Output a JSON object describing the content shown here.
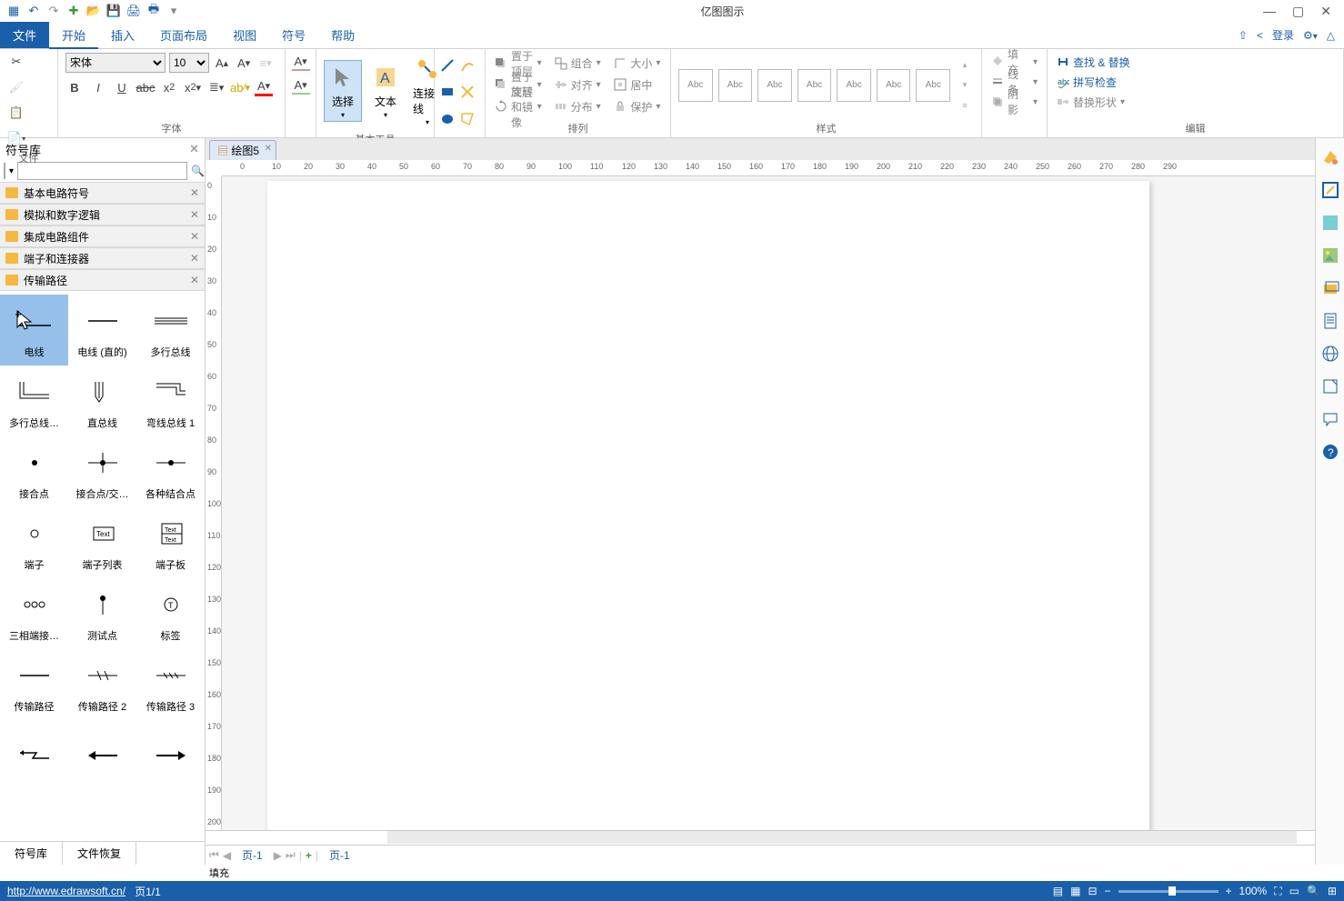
{
  "app": {
    "title": "亿图图示"
  },
  "qat": [
    "logo",
    "undo",
    "redo",
    "sep",
    "new",
    "open",
    "save",
    "print",
    "quickprint",
    "more"
  ],
  "window_controls": [
    "min",
    "max",
    "close"
  ],
  "menubar": {
    "tabs": [
      {
        "id": "file",
        "label": "文件",
        "type": "file"
      },
      {
        "id": "start",
        "label": "开始",
        "active": true
      },
      {
        "id": "insert",
        "label": "插入"
      },
      {
        "id": "layout",
        "label": "页面布局"
      },
      {
        "id": "view",
        "label": "视图"
      },
      {
        "id": "symbol",
        "label": "符号"
      },
      {
        "id": "help",
        "label": "帮助"
      }
    ],
    "right": [
      {
        "id": "export",
        "glyph": "⇪"
      },
      {
        "id": "share",
        "glyph": "<"
      },
      {
        "id": "login",
        "label": "登录"
      },
      {
        "id": "settings",
        "glyph": "⚙"
      },
      {
        "id": "collapse",
        "glyph": "△"
      }
    ]
  },
  "ribbon": {
    "groups": [
      {
        "id": "file",
        "label": "文件"
      },
      {
        "id": "font",
        "label": "字体",
        "font_name": "宋体",
        "font_size": "10"
      },
      {
        "id": "para",
        "label": ""
      },
      {
        "id": "basic",
        "label": "基本工具",
        "items": [
          {
            "id": "select",
            "label": "选择",
            "selected": true
          },
          {
            "id": "text",
            "label": "文本"
          },
          {
            "id": "connector",
            "label": "连接线"
          }
        ]
      },
      {
        "id": "shapes",
        "label": ""
      },
      {
        "id": "arrange",
        "label": "排列",
        "rows": [
          {
            "id": "top",
            "label": "置于顶层"
          },
          {
            "id": "group",
            "label": "组合"
          },
          {
            "id": "size",
            "label": "大小"
          },
          {
            "id": "bottom",
            "label": "置于底层"
          },
          {
            "id": "align",
            "label": "对齐"
          },
          {
            "id": "center",
            "label": "居中"
          },
          {
            "id": "rotate",
            "label": "旋转和镜像"
          },
          {
            "id": "distribute",
            "label": "分布"
          },
          {
            "id": "protect",
            "label": "保护"
          }
        ]
      },
      {
        "id": "style",
        "label": "样式",
        "box": "Abc",
        "count": 7
      },
      {
        "id": "fillline",
        "label": "",
        "rows": [
          {
            "id": "fill",
            "label": "填充"
          },
          {
            "id": "line",
            "label": "线条"
          },
          {
            "id": "shadow",
            "label": "阴影"
          }
        ]
      },
      {
        "id": "edit",
        "label": "编辑",
        "rows": [
          {
            "id": "find",
            "label": "查找 & 替换"
          },
          {
            "id": "spell",
            "label": "拼写检查"
          },
          {
            "id": "reshape",
            "label": "替换形状"
          }
        ]
      }
    ]
  },
  "sidebar": {
    "title": "符号库",
    "categories": [
      {
        "id": "basic",
        "label": "基本电路符号"
      },
      {
        "id": "analog",
        "label": "模拟和数字逻辑"
      },
      {
        "id": "ic",
        "label": "集成电路组件"
      },
      {
        "id": "term",
        "label": "端子和连接器"
      },
      {
        "id": "path",
        "label": "传输路径",
        "open": true
      }
    ],
    "symbols": [
      {
        "id": "wire",
        "label": "电线",
        "selected": true
      },
      {
        "id": "wire_straight",
        "label": "电线 (直的)"
      },
      {
        "id": "multibus",
        "label": "多行总线"
      },
      {
        "id": "multibus2",
        "label": "多行总线…"
      },
      {
        "id": "vbus",
        "label": "直总线"
      },
      {
        "id": "curvebus1",
        "label": "弯线总线 1"
      },
      {
        "id": "junction",
        "label": "接合点"
      },
      {
        "id": "junction_x",
        "label": "接合点/交…"
      },
      {
        "id": "junctions",
        "label": "各种结合点"
      },
      {
        "id": "terminal",
        "label": "端子"
      },
      {
        "id": "termlist",
        "label": "端子列表"
      },
      {
        "id": "termboard",
        "label": "端子板"
      },
      {
        "id": "triphase",
        "label": "三相端接…"
      },
      {
        "id": "testpoint",
        "label": "测试点"
      },
      {
        "id": "tag",
        "label": "标签"
      },
      {
        "id": "tpath",
        "label": "传输路径"
      },
      {
        "id": "tpath2",
        "label": "传输路径 2"
      },
      {
        "id": "tpath3",
        "label": "传输路径 3"
      }
    ],
    "bottom_tabs": [
      {
        "id": "symlib",
        "label": "符号库"
      },
      {
        "id": "recover",
        "label": "文件恢复"
      }
    ]
  },
  "document": {
    "tab_name": "绘图5",
    "ruler_h": [
      0,
      10,
      20,
      30,
      40,
      50,
      60,
      70,
      80,
      90,
      100,
      110,
      120,
      130,
      140,
      150,
      160,
      170,
      180,
      190,
      200,
      210,
      220,
      230,
      240,
      250,
      260,
      270,
      280,
      290
    ],
    "ruler_v": [
      0,
      10,
      20,
      30,
      40,
      50,
      60,
      70,
      80,
      90,
      100,
      110,
      120,
      130,
      140,
      150,
      160,
      170,
      180,
      190,
      200
    ],
    "page_tabs": {
      "current": "页-1",
      "add": "+",
      "list": "页-1"
    }
  },
  "colorbar": {
    "label": "填充",
    "colors": [
      "#000000",
      "#1a1a1a",
      "#333333",
      "#4d4d4d",
      "#666666",
      "#808080",
      "#999999",
      "#b3b3b3",
      "#cccccc",
      "#e6e6e6",
      "#f5f5f5",
      "#ffffff",
      "#800000",
      "#a00000",
      "#c00000",
      "#e00000",
      "#ff0000",
      "#ff4d4d",
      "#ff8080",
      "#ffb3b3",
      "#804000",
      "#a05000",
      "#c06000",
      "#e07000",
      "#ff8000",
      "#ffa040",
      "#ffc080",
      "#ffe0c0",
      "#808000",
      "#a0a000",
      "#c0c000",
      "#e0e000",
      "#ffff00",
      "#ffff60",
      "#ffffa0",
      "#ffffd0",
      "#008000",
      "#00a000",
      "#00c000",
      "#00e000",
      "#00ff00",
      "#60ff60",
      "#a0ffa0",
      "#d0ffd0",
      "#008080",
      "#00a0a0",
      "#00c0c0",
      "#00e0e0",
      "#00ffff",
      "#60ffff",
      "#a0ffff",
      "#d0ffff",
      "#000080",
      "#0000a0",
      "#0000c0",
      "#0000e0",
      "#0000ff",
      "#6060ff",
      "#a0a0ff",
      "#d0d0ff",
      "#400080",
      "#5000a0",
      "#6000c0",
      "#7000e0",
      "#8000ff",
      "#a060ff",
      "#c0a0ff",
      "#e0d0ff",
      "#800080",
      "#a000a0",
      "#c000c0",
      "#e000e0",
      "#ff00ff",
      "#ff60ff",
      "#ffa0ff",
      "#ffd0ff",
      "#800040",
      "#a00050",
      "#c00060",
      "#e00070",
      "#ff0080",
      "#ff60a0",
      "#ffa0c0",
      "#ffd0e0"
    ]
  },
  "status": {
    "url": "http://www.edrawsoft.cn/",
    "page": "页1/1",
    "zoom": "100%"
  }
}
